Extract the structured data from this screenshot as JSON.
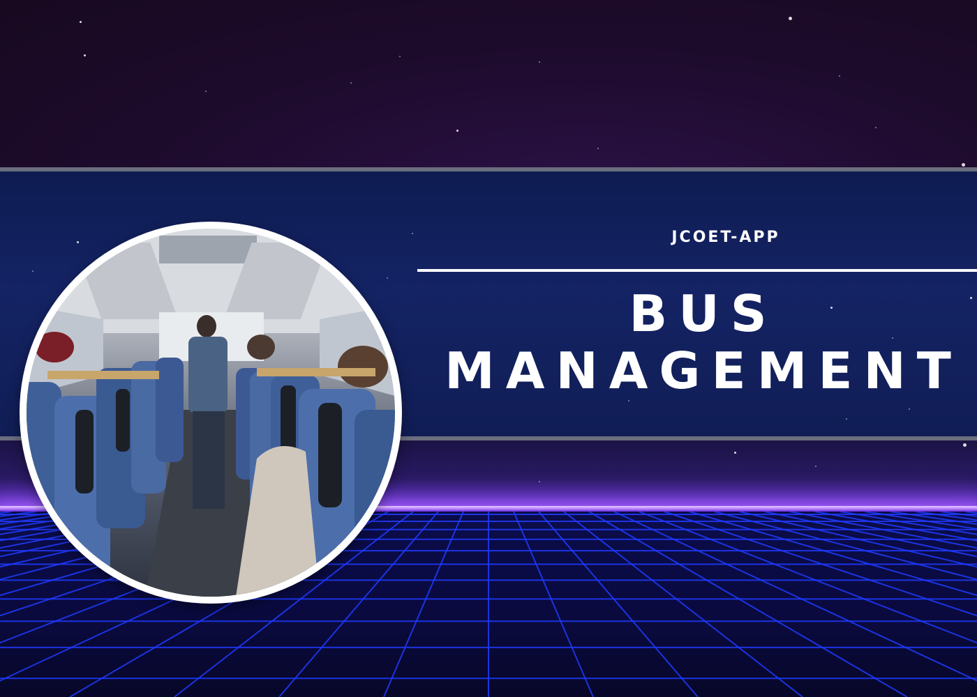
{
  "header": {
    "app_name": "JCOET-APP"
  },
  "title": {
    "line1": "BUS",
    "line2": "MANAGEMENT"
  },
  "hero_image": {
    "subject": "bus interior with seats and passengers"
  },
  "colors": {
    "sky": "#1d0b2c",
    "band": "#142364",
    "divider": "#6b6e7e",
    "horizon_glow": "#b980ff",
    "grid_line": "#1f3bff",
    "text": "#ffffff"
  }
}
